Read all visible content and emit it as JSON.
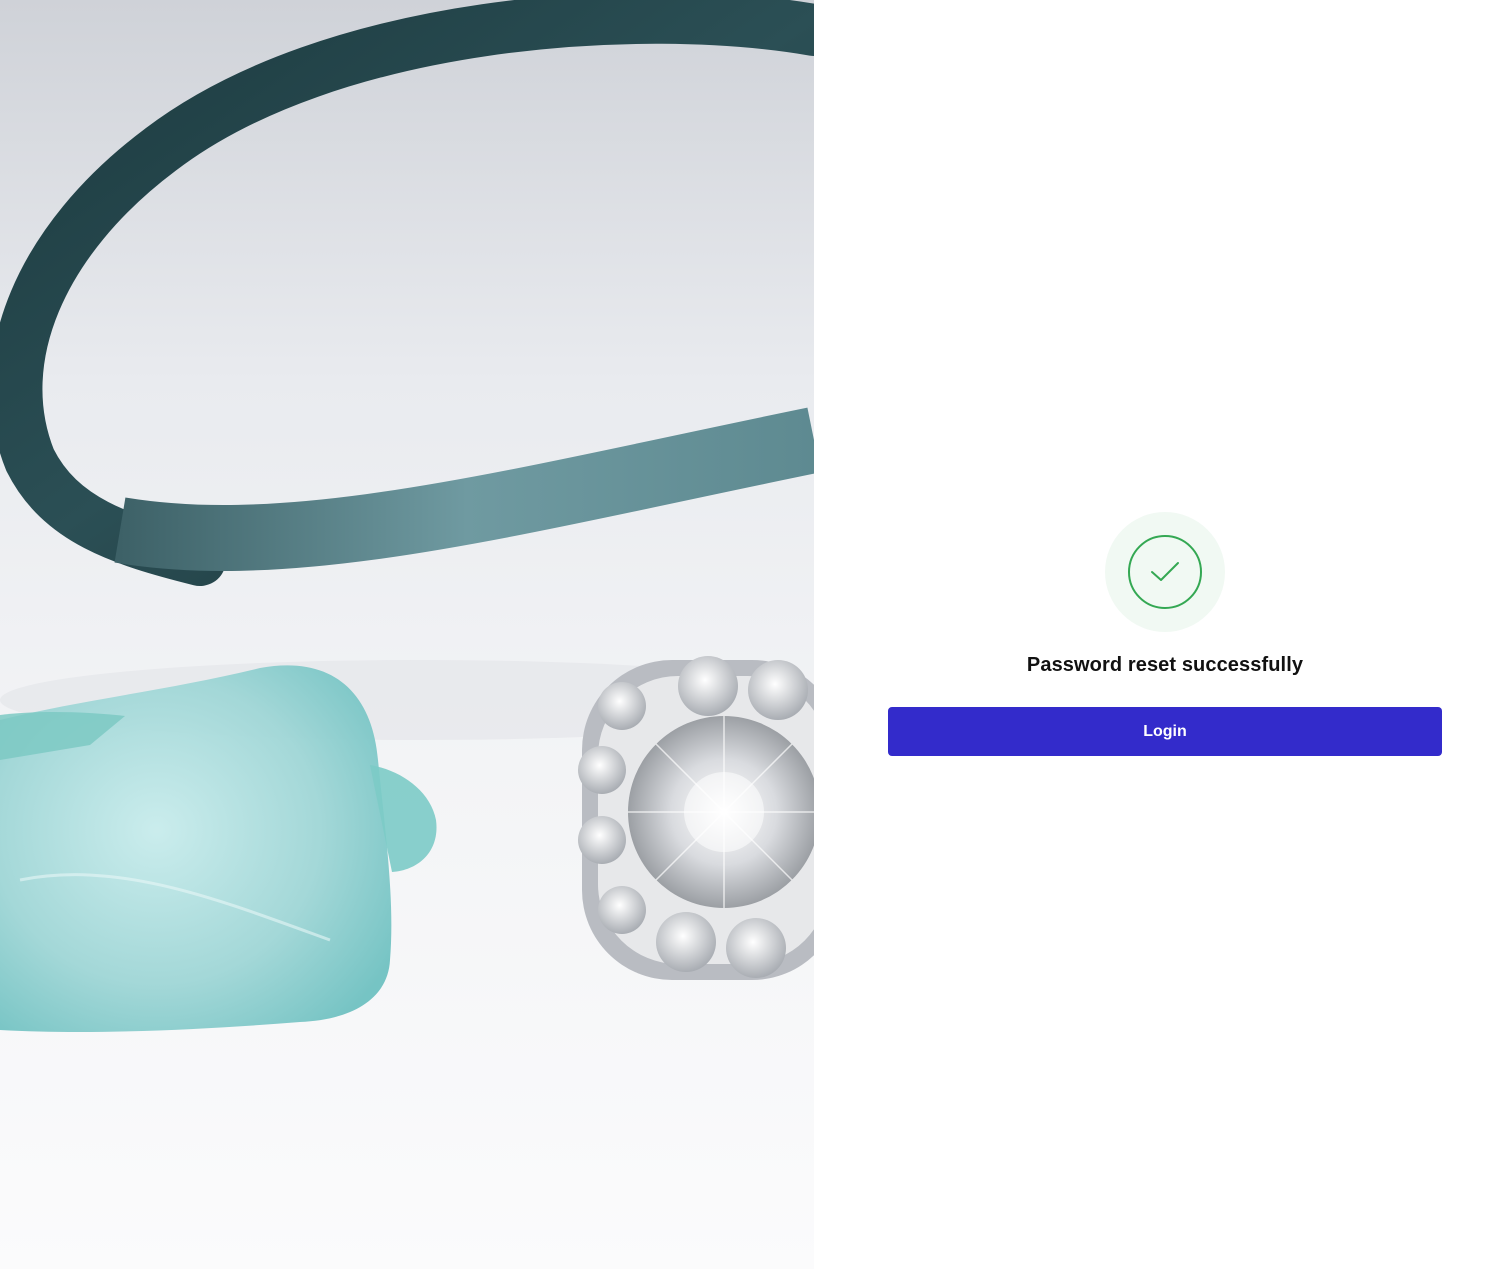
{
  "hero": {
    "image": "jewelry-photo",
    "description_icons": [
      "ribbon",
      "sea-glass",
      "diamond-ring"
    ]
  },
  "status": {
    "icon": "check-circle-icon",
    "title": "Password reset successfully",
    "accent_color": "#34a853"
  },
  "actions": {
    "login_label": "Login",
    "button_color": "#332bcb"
  }
}
